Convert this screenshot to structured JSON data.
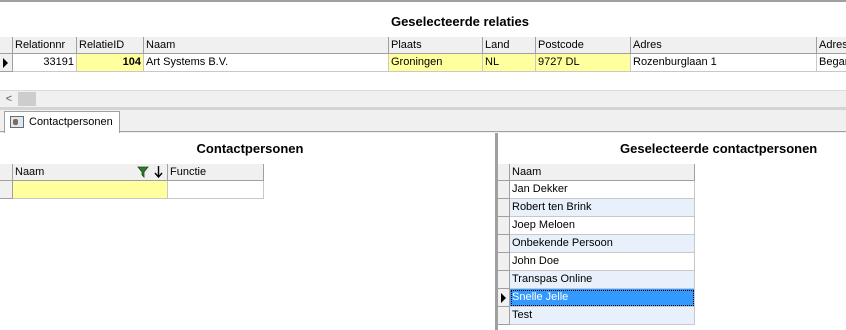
{
  "relaties": {
    "title": "Geselecteerde relaties",
    "columns": [
      "Relationnr",
      "RelatieID",
      "Naam",
      "Plaats",
      "Land",
      "Postcode",
      "Adres",
      "Adres"
    ],
    "row": [
      "33191",
      "104",
      "Art Systems B.V.",
      "Groningen",
      "NL",
      "9727 DL",
      "Rozenburglaan 1",
      "Begar"
    ]
  },
  "scroll": {
    "left_arrow": "<"
  },
  "tab": {
    "label": "Contactpersonen"
  },
  "contactpersonen": {
    "title": "Contactpersonen",
    "columns": [
      "Naam",
      "Functie"
    ]
  },
  "geselecteerd": {
    "title": "Geselecteerde contactpersonen",
    "column": "Naam",
    "rows": [
      "Jan Dekker",
      "Robert ten Brink",
      "Joep Meloen",
      "Onbekende Persoon",
      "John Doe",
      "Transpas Online",
      "Snelle Jelle",
      "Test"
    ],
    "selected_index": 6
  },
  "colors": {
    "highlight": "#ffff9e",
    "selection": "#3399ff",
    "alt_row": "#e7f0fb"
  }
}
